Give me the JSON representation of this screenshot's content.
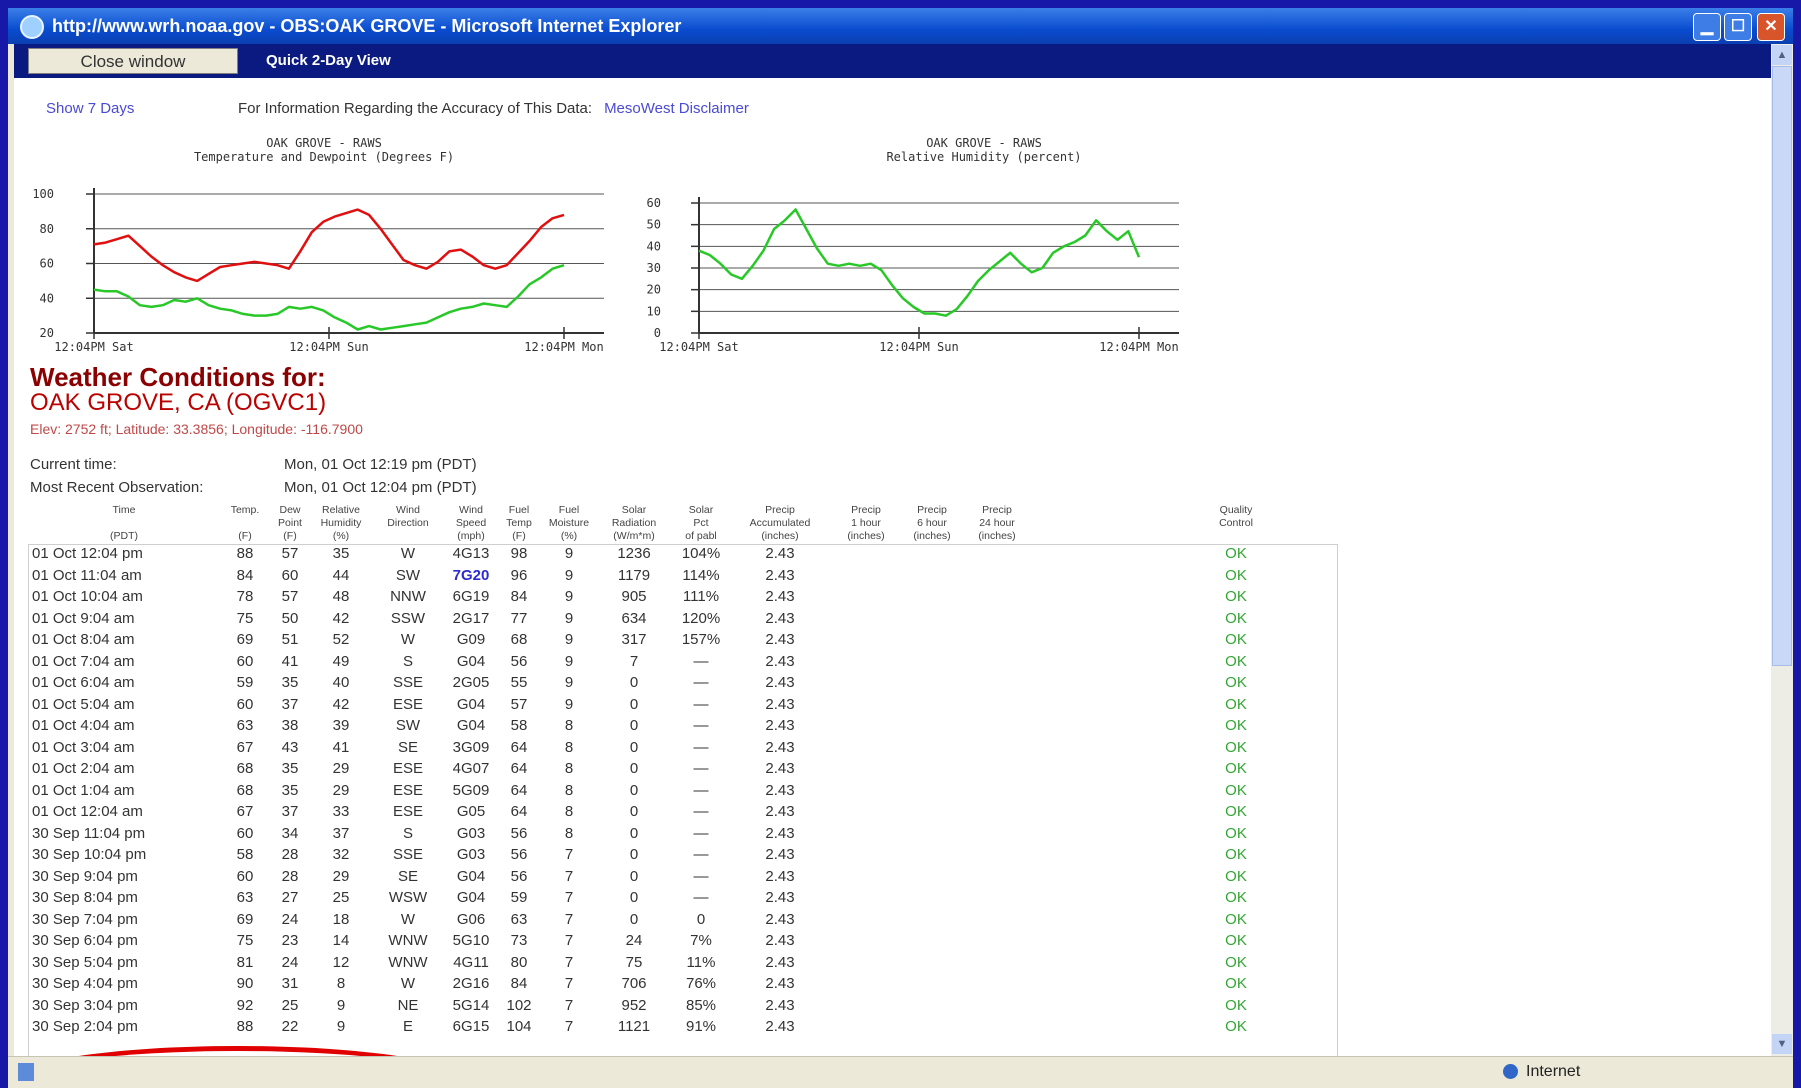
{
  "window": {
    "title": "http://www.wrh.noaa.gov - OBS:OAK GROVE - Microsoft Internet Explorer",
    "controls": {
      "minimize": "▁",
      "maximize": "☐",
      "close": "✕"
    }
  },
  "page": {
    "close_window": "Close window",
    "quick_view": "Quick 2-Day View",
    "show_7_days": "Show 7 Days",
    "disclaimer_text": "For Information Regarding the Accuracy of This Data:",
    "disclaimer_link": "MesoWest Disclaimer"
  },
  "chart_data": [
    {
      "type": "line",
      "title": "OAK GROVE - RAWS",
      "subtitle": "Temperature and Dewpoint (Degrees F)",
      "ylim": [
        20,
        100
      ],
      "yticks": [
        "100",
        "80",
        "60",
        "40",
        "20"
      ],
      "xtick_labels": [
        "12:04PM Sat",
        "12:04PM Sun",
        "12:04PM Mon"
      ],
      "series": [
        {
          "color": "#e01010",
          "values": [
            71,
            72,
            74,
            76,
            70,
            64,
            59,
            55,
            52,
            50,
            54,
            58,
            59,
            60,
            61,
            60,
            59,
            57,
            67,
            78,
            84,
            87,
            89,
            91,
            88,
            80,
            71,
            62,
            59,
            57,
            61,
            67,
            68,
            64,
            59,
            57,
            59,
            66,
            73,
            81,
            86,
            88
          ]
        },
        {
          "color": "#28c828",
          "values": [
            45,
            44,
            44,
            41,
            36,
            35,
            36,
            39,
            38,
            40,
            36,
            34,
            33,
            31,
            30,
            30,
            31,
            35,
            34,
            35,
            33,
            29,
            26,
            22,
            24,
            22,
            23,
            24,
            25,
            26,
            29,
            32,
            34,
            35,
            37,
            36,
            35,
            41,
            48,
            52,
            57,
            59
          ]
        }
      ]
    },
    {
      "type": "line",
      "title": "OAK GROVE - RAWS",
      "subtitle": "Relative Humidity (percent)",
      "ylim": [
        0,
        60
      ],
      "yticks": [
        "60",
        "50",
        "40",
        "30",
        "20",
        "10",
        "0"
      ],
      "xtick_labels": [
        "12:04PM Sat",
        "12:04PM Sun",
        "12:04PM Mon"
      ],
      "series": [
        {
          "color": "#28c828",
          "values": [
            38,
            36,
            32,
            27,
            25,
            31,
            38,
            48,
            52,
            57,
            48,
            39,
            32,
            31,
            32,
            31,
            32,
            29,
            22,
            16,
            12,
            9,
            9,
            8,
            11,
            17,
            24,
            29,
            33,
            37,
            32,
            28,
            30,
            37,
            40,
            42,
            45,
            52,
            47,
            43,
            47,
            35
          ]
        }
      ]
    }
  ],
  "station": {
    "heading": "Weather Conditions for:",
    "name": "OAK GROVE, CA (OGVC1)",
    "elev": "Elev: 2752 ft; Latitude: 33.3856; Longitude: -116.7900",
    "current_time_label": "Current time:",
    "current_time": "Mon, 01 Oct 12:19 pm (PDT)",
    "most_recent_label": "Most Recent Observation:",
    "most_recent": "Mon, 01 Oct 12:04 pm (PDT)"
  },
  "table": {
    "header_row1": [
      "Time",
      "Temp.",
      "Dew",
      "Relative",
      "Wind",
      "Wind",
      "Fuel",
      "Fuel",
      "Solar",
      "Solar",
      "Precip",
      "Precip",
      "Precip",
      "Precip",
      "Quality"
    ],
    "header_row2": [
      "",
      "",
      "Point",
      "Humidity",
      "Direction",
      "Speed",
      "Temp",
      "Moisture",
      "Radiation",
      "Pct",
      "Accumulated",
      "1 hour",
      "6 hour",
      "24 hour",
      "Control"
    ],
    "header_row3": [
      "(PDT)",
      "(F)",
      "(F)",
      "(%)",
      "",
      "(mph)",
      "(F)",
      "(%)",
      "(W/m*m)",
      "of pabl",
      "(inches)",
      "(inches)",
      "(inches)",
      "(inches)",
      ""
    ],
    "rows": [
      [
        "01 Oct 12:04 pm",
        "88",
        "57",
        "35",
        "W",
        "4G13",
        "98",
        "9",
        "1236",
        "104%",
        "2.43",
        "",
        "",
        "",
        "OK"
      ],
      [
        "01 Oct 11:04 am",
        "84",
        "60",
        "44",
        "SW",
        "7G20",
        "96",
        "9",
        "1179",
        "114%",
        "2.43",
        "",
        "",
        "",
        "OK"
      ],
      [
        "01 Oct 10:04 am",
        "78",
        "57",
        "48",
        "NNW",
        "6G19",
        "84",
        "9",
        "905",
        "111%",
        "2.43",
        "",
        "",
        "",
        "OK"
      ],
      [
        "01 Oct 9:04 am",
        "75",
        "50",
        "42",
        "SSW",
        "2G17",
        "77",
        "9",
        "634",
        "120%",
        "2.43",
        "",
        "",
        "",
        "OK"
      ],
      [
        "01 Oct 8:04 am",
        "69",
        "51",
        "52",
        "W",
        "G09",
        "68",
        "9",
        "317",
        "157%",
        "2.43",
        "",
        "",
        "",
        "OK"
      ],
      [
        "01 Oct 7:04 am",
        "60",
        "41",
        "49",
        "S",
        "G04",
        "56",
        "9",
        "7",
        "—",
        "2.43",
        "",
        "",
        "",
        "OK"
      ],
      [
        "01 Oct 6:04 am",
        "59",
        "35",
        "40",
        "SSE",
        "2G05",
        "55",
        "9",
        "0",
        "—",
        "2.43",
        "",
        "",
        "",
        "OK"
      ],
      [
        "01 Oct 5:04 am",
        "60",
        "37",
        "42",
        "ESE",
        "G04",
        "57",
        "9",
        "0",
        "—",
        "2.43",
        "",
        "",
        "",
        "OK"
      ],
      [
        "01 Oct 4:04 am",
        "63",
        "38",
        "39",
        "SW",
        "G04",
        "58",
        "8",
        "0",
        "—",
        "2.43",
        "",
        "",
        "",
        "OK"
      ],
      [
        "01 Oct 3:04 am",
        "67",
        "43",
        "41",
        "SE",
        "3G09",
        "64",
        "8",
        "0",
        "—",
        "2.43",
        "",
        "",
        "",
        "OK"
      ],
      [
        "01 Oct 2:04 am",
        "68",
        "35",
        "29",
        "ESE",
        "4G07",
        "64",
        "8",
        "0",
        "—",
        "2.43",
        "",
        "",
        "",
        "OK"
      ],
      [
        "01 Oct 1:04 am",
        "68",
        "35",
        "29",
        "ESE",
        "5G09",
        "64",
        "8",
        "0",
        "—",
        "2.43",
        "",
        "",
        "",
        "OK"
      ],
      [
        "01 Oct 12:04 am",
        "67",
        "37",
        "33",
        "ESE",
        "G05",
        "64",
        "8",
        "0",
        "—",
        "2.43",
        "",
        "",
        "",
        "OK"
      ],
      [
        "30 Sep 11:04 pm",
        "60",
        "34",
        "37",
        "S",
        "G03",
        "56",
        "8",
        "0",
        "—",
        "2.43",
        "",
        "",
        "",
        "OK"
      ],
      [
        "30 Sep 10:04 pm",
        "58",
        "28",
        "32",
        "SSE",
        "G03",
        "56",
        "7",
        "0",
        "—",
        "2.43",
        "",
        "",
        "",
        "OK"
      ],
      [
        "30 Sep 9:04 pm",
        "60",
        "28",
        "29",
        "SE",
        "G04",
        "56",
        "7",
        "0",
        "—",
        "2.43",
        "",
        "",
        "",
        "OK"
      ],
      [
        "30 Sep 8:04 pm",
        "63",
        "27",
        "25",
        "WSW",
        "G04",
        "59",
        "7",
        "0",
        "—",
        "2.43",
        "",
        "",
        "",
        "OK"
      ],
      [
        "30 Sep 7:04 pm",
        "69",
        "24",
        "18",
        "W",
        "G06",
        "63",
        "7",
        "0",
        "0",
        "2.43",
        "",
        "",
        "",
        "OK"
      ],
      [
        "30 Sep 6:04 pm",
        "75",
        "23",
        "14",
        "WNW",
        "5G10",
        "73",
        "7",
        "24",
        "7%",
        "2.43",
        "",
        "",
        "",
        "OK"
      ],
      [
        "30 Sep 5:04 pm",
        "81",
        "24",
        "12",
        "WNW",
        "4G11",
        "80",
        "7",
        "75",
        "11%",
        "2.43",
        "",
        "",
        "",
        "OK"
      ],
      [
        "30 Sep 4:04 pm",
        "90",
        "31",
        "8",
        "W",
        "2G16",
        "84",
        "7",
        "706",
        "76%",
        "2.43",
        "",
        "",
        "",
        "OK"
      ],
      [
        "30 Sep 3:04 pm",
        "92",
        "25",
        "9",
        "NE",
        "5G14",
        "102",
        "7",
        "952",
        "85%",
        "2.43",
        "",
        "",
        "",
        "OK"
      ],
      [
        "30 Sep 2:04 pm",
        "88",
        "22",
        "9",
        "E",
        "6G15",
        "104",
        "7",
        "1121",
        "91%",
        "2.43",
        "",
        "",
        "",
        "OK"
      ]
    ]
  },
  "statusbar": {
    "zone": "Internet"
  }
}
